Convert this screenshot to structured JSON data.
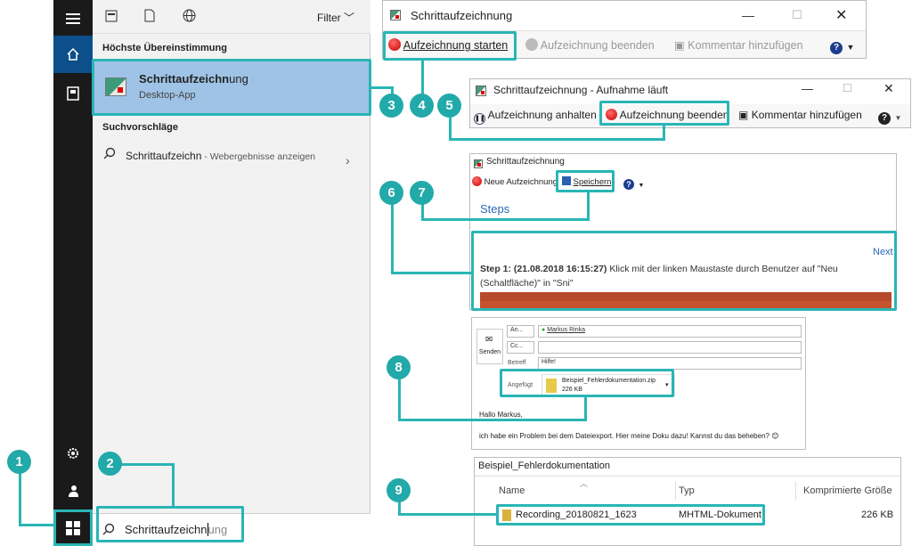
{
  "taskbar": {
    "search_box": {
      "typed": "Schrittaufzeichn",
      "completion": "ung"
    }
  },
  "start_menu": {
    "filter_label": "Filter",
    "best_match_header": "Höchste Übereinstimmung",
    "best_match": {
      "name_bold": "Schrittaufzeichn",
      "name_rest": "ung",
      "type": "Desktop-App"
    },
    "suggestions_header": "Suchvorschläge",
    "suggestion": {
      "text": "Schrittaufzeichn",
      "suffix": " - Webergebnisse anzeigen"
    }
  },
  "window_psr": {
    "title": "Schrittaufzeichnung",
    "start": "Aufzeichnung starten",
    "stop": "Aufzeichnung beenden",
    "comment": "Kommentar hinzufügen"
  },
  "window_recording": {
    "title": "Schrittaufzeichnung - Aufnahme läuft",
    "pause": "Aufzeichnung anhalten",
    "stop": "Aufzeichnung beenden",
    "comment": "Kommentar hinzufügen"
  },
  "window_result": {
    "title": "Schrittaufzeichnung",
    "new_recording": "Neue Aufzeichnung",
    "save": "Speichern",
    "steps_heading": "Steps",
    "next": "Next",
    "step_label": "Step 1: (21.08.2018 16:15:27)",
    "step_text": " Klick mit der linken Maustaste durch Benutzer auf \"Neu (Schaltfläche)\" in \"Sni\""
  },
  "email": {
    "send": "Senden",
    "to_label": "An...",
    "cc_label": "Cc...",
    "subject_label": "Betreff",
    "to_value": "Markus Rinka",
    "subject_value": "Hilfe!",
    "attached_label": "Angefügt",
    "attachment_name": "Beispiel_Fehlerdokumentation.zip",
    "attachment_size": "226 KB",
    "greeting": "Hallo Markus,",
    "body": "ich habe ein Problem bei dem Dateiexport. Hier meine Doku dazu! Kannst du das beheben? 😊"
  },
  "zip": {
    "title": "Beispiel_Fehlerdokumentation",
    "col_name": "Name",
    "col_type": "Typ",
    "col_size": "Komprimierte Größe",
    "file_name": "Recording_20180821_1623",
    "file_type": "MHTML-Dokument",
    "file_size": "226 KB"
  },
  "badges": [
    "1",
    "2",
    "3",
    "4",
    "5",
    "6",
    "7",
    "8",
    "9"
  ],
  "colors": {
    "highlight": "#2ab5b5",
    "badge": "#22a9a9",
    "selection": "#9fc3e7",
    "taskbar": "#1a1a1a"
  }
}
